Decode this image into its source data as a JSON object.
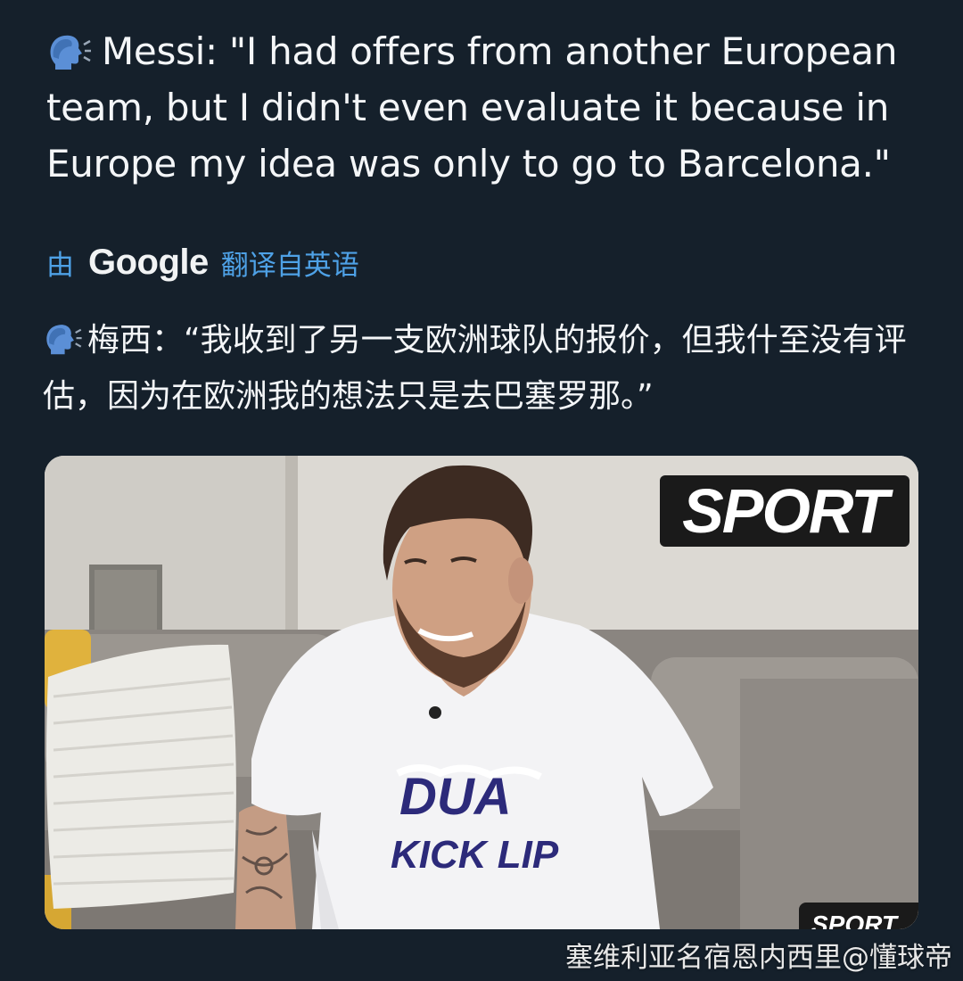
{
  "tweet": {
    "speaking_icon": "speaking-head-icon",
    "text": "Messi: \"I had offers from another European team, but I didn't even evaluate it because in Europe my idea was only to go to Barcelona.\""
  },
  "translation": {
    "prefix": "由",
    "provider": "Google",
    "suffix": "翻译自英语",
    "speaking_icon": "speaking-head-icon",
    "text": "梅西：“我收到了另一支欧洲球队的报价，但我什至没有评估，因为在欧洲我的想法只是去巴塞罗那。”"
  },
  "media": {
    "logo_text": "SPORT",
    "corner_logo_text": "SPORT",
    "shirt_print": "DUA KICK LIP"
  },
  "watermark": "塞维利亚名宿恩内西里@懂球帝",
  "colors": {
    "background": "#15202b",
    "text": "#f4f6f8",
    "link": "#4ea1e6"
  }
}
